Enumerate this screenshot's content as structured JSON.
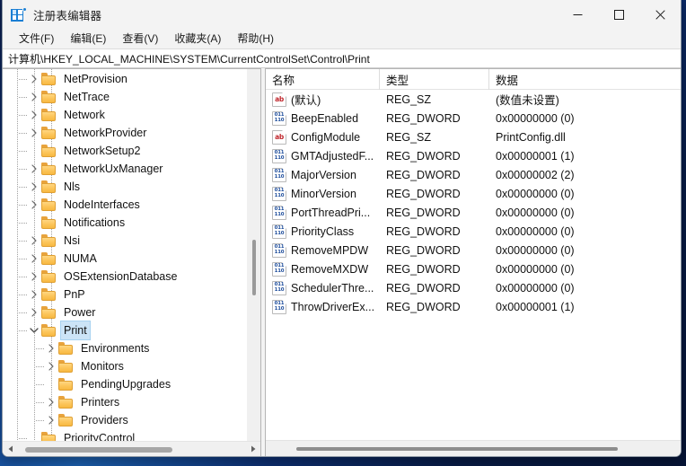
{
  "window": {
    "title": "注册表编辑器",
    "app_icon": "registry-grid-icon",
    "controls": {
      "minimize": "最小化",
      "maximize": "最大化",
      "close": "关闭"
    }
  },
  "menubar": {
    "items": [
      {
        "label": "文件(F)",
        "name": "menu-file"
      },
      {
        "label": "编辑(E)",
        "name": "menu-edit"
      },
      {
        "label": "查看(V)",
        "name": "menu-view"
      },
      {
        "label": "收藏夹(A)",
        "name": "menu-favorites"
      },
      {
        "label": "帮助(H)",
        "name": "menu-help"
      }
    ]
  },
  "address": {
    "path": "计算机\\HKEY_LOCAL_MACHINE\\SYSTEM\\CurrentControlSet\\Control\\Print"
  },
  "tree": {
    "items": [
      {
        "label": "NetProvision",
        "depth": 1,
        "state": "collapsed"
      },
      {
        "label": "NetTrace",
        "depth": 1,
        "state": "collapsed"
      },
      {
        "label": "Network",
        "depth": 1,
        "state": "collapsed"
      },
      {
        "label": "NetworkProvider",
        "depth": 1,
        "state": "collapsed"
      },
      {
        "label": "NetworkSetup2",
        "depth": 1,
        "state": "leaf"
      },
      {
        "label": "NetworkUxManager",
        "depth": 1,
        "state": "collapsed"
      },
      {
        "label": "Nls",
        "depth": 1,
        "state": "collapsed"
      },
      {
        "label": "NodeInterfaces",
        "depth": 1,
        "state": "collapsed"
      },
      {
        "label": "Notifications",
        "depth": 1,
        "state": "leaf"
      },
      {
        "label": "Nsi",
        "depth": 1,
        "state": "collapsed"
      },
      {
        "label": "NUMA",
        "depth": 1,
        "state": "collapsed"
      },
      {
        "label": "OSExtensionDatabase",
        "depth": 1,
        "state": "collapsed"
      },
      {
        "label": "PnP",
        "depth": 1,
        "state": "collapsed"
      },
      {
        "label": "Power",
        "depth": 1,
        "state": "collapsed"
      },
      {
        "label": "Print",
        "depth": 1,
        "state": "expanded",
        "selected": true
      },
      {
        "label": "Environments",
        "depth": 2,
        "state": "collapsed"
      },
      {
        "label": "Monitors",
        "depth": 2,
        "state": "collapsed"
      },
      {
        "label": "PendingUpgrades",
        "depth": 2,
        "state": "leaf"
      },
      {
        "label": "Printers",
        "depth": 2,
        "state": "collapsed"
      },
      {
        "label": "Providers",
        "depth": 2,
        "state": "collapsed"
      },
      {
        "label": "PriorityControl",
        "depth": 1,
        "state": "leaf"
      }
    ]
  },
  "list": {
    "columns": [
      {
        "label": "名称",
        "name": "column-name"
      },
      {
        "label": "类型",
        "name": "column-type"
      },
      {
        "label": "数据",
        "name": "column-data"
      }
    ],
    "rows": [
      {
        "name": "(默认)",
        "type": "REG_SZ",
        "data": "(数值未设置)",
        "icon": "string-value-icon"
      },
      {
        "name": "BeepEnabled",
        "type": "REG_DWORD",
        "data": "0x00000000 (0)",
        "icon": "dword-value-icon"
      },
      {
        "name": "ConfigModule",
        "type": "REG_SZ",
        "data": "PrintConfig.dll",
        "icon": "string-value-icon"
      },
      {
        "name": "GMTAdjustedF...",
        "type": "REG_DWORD",
        "data": "0x00000001 (1)",
        "icon": "dword-value-icon"
      },
      {
        "name": "MajorVersion",
        "type": "REG_DWORD",
        "data": "0x00000002 (2)",
        "icon": "dword-value-icon"
      },
      {
        "name": "MinorVersion",
        "type": "REG_DWORD",
        "data": "0x00000000 (0)",
        "icon": "dword-value-icon"
      },
      {
        "name": "PortThreadPri...",
        "type": "REG_DWORD",
        "data": "0x00000000 (0)",
        "icon": "dword-value-icon"
      },
      {
        "name": "PriorityClass",
        "type": "REG_DWORD",
        "data": "0x00000000 (0)",
        "icon": "dword-value-icon"
      },
      {
        "name": "RemoveMPDW",
        "type": "REG_DWORD",
        "data": "0x00000000 (0)",
        "icon": "dword-value-icon"
      },
      {
        "name": "RemoveMXDW",
        "type": "REG_DWORD",
        "data": "0x00000000 (0)",
        "icon": "dword-value-icon"
      },
      {
        "name": "SchedulerThre...",
        "type": "REG_DWORD",
        "data": "0x00000000 (0)",
        "icon": "dword-value-icon"
      },
      {
        "name": "ThrowDriverEx...",
        "type": "REG_DWORD",
        "data": "0x00000001 (1)",
        "icon": "dword-value-icon"
      }
    ]
  },
  "icon_glyphs": {
    "string_value": "ab",
    "dword_top": "011",
    "dword_bottom": "110"
  },
  "colors": {
    "selection": "#cce4f7",
    "folder": "#fcc459",
    "string_icon": "#c1272d",
    "dword_icon": "#1f4e9c",
    "window_bg": "#f3f3f3",
    "desktop": "#123b86"
  }
}
